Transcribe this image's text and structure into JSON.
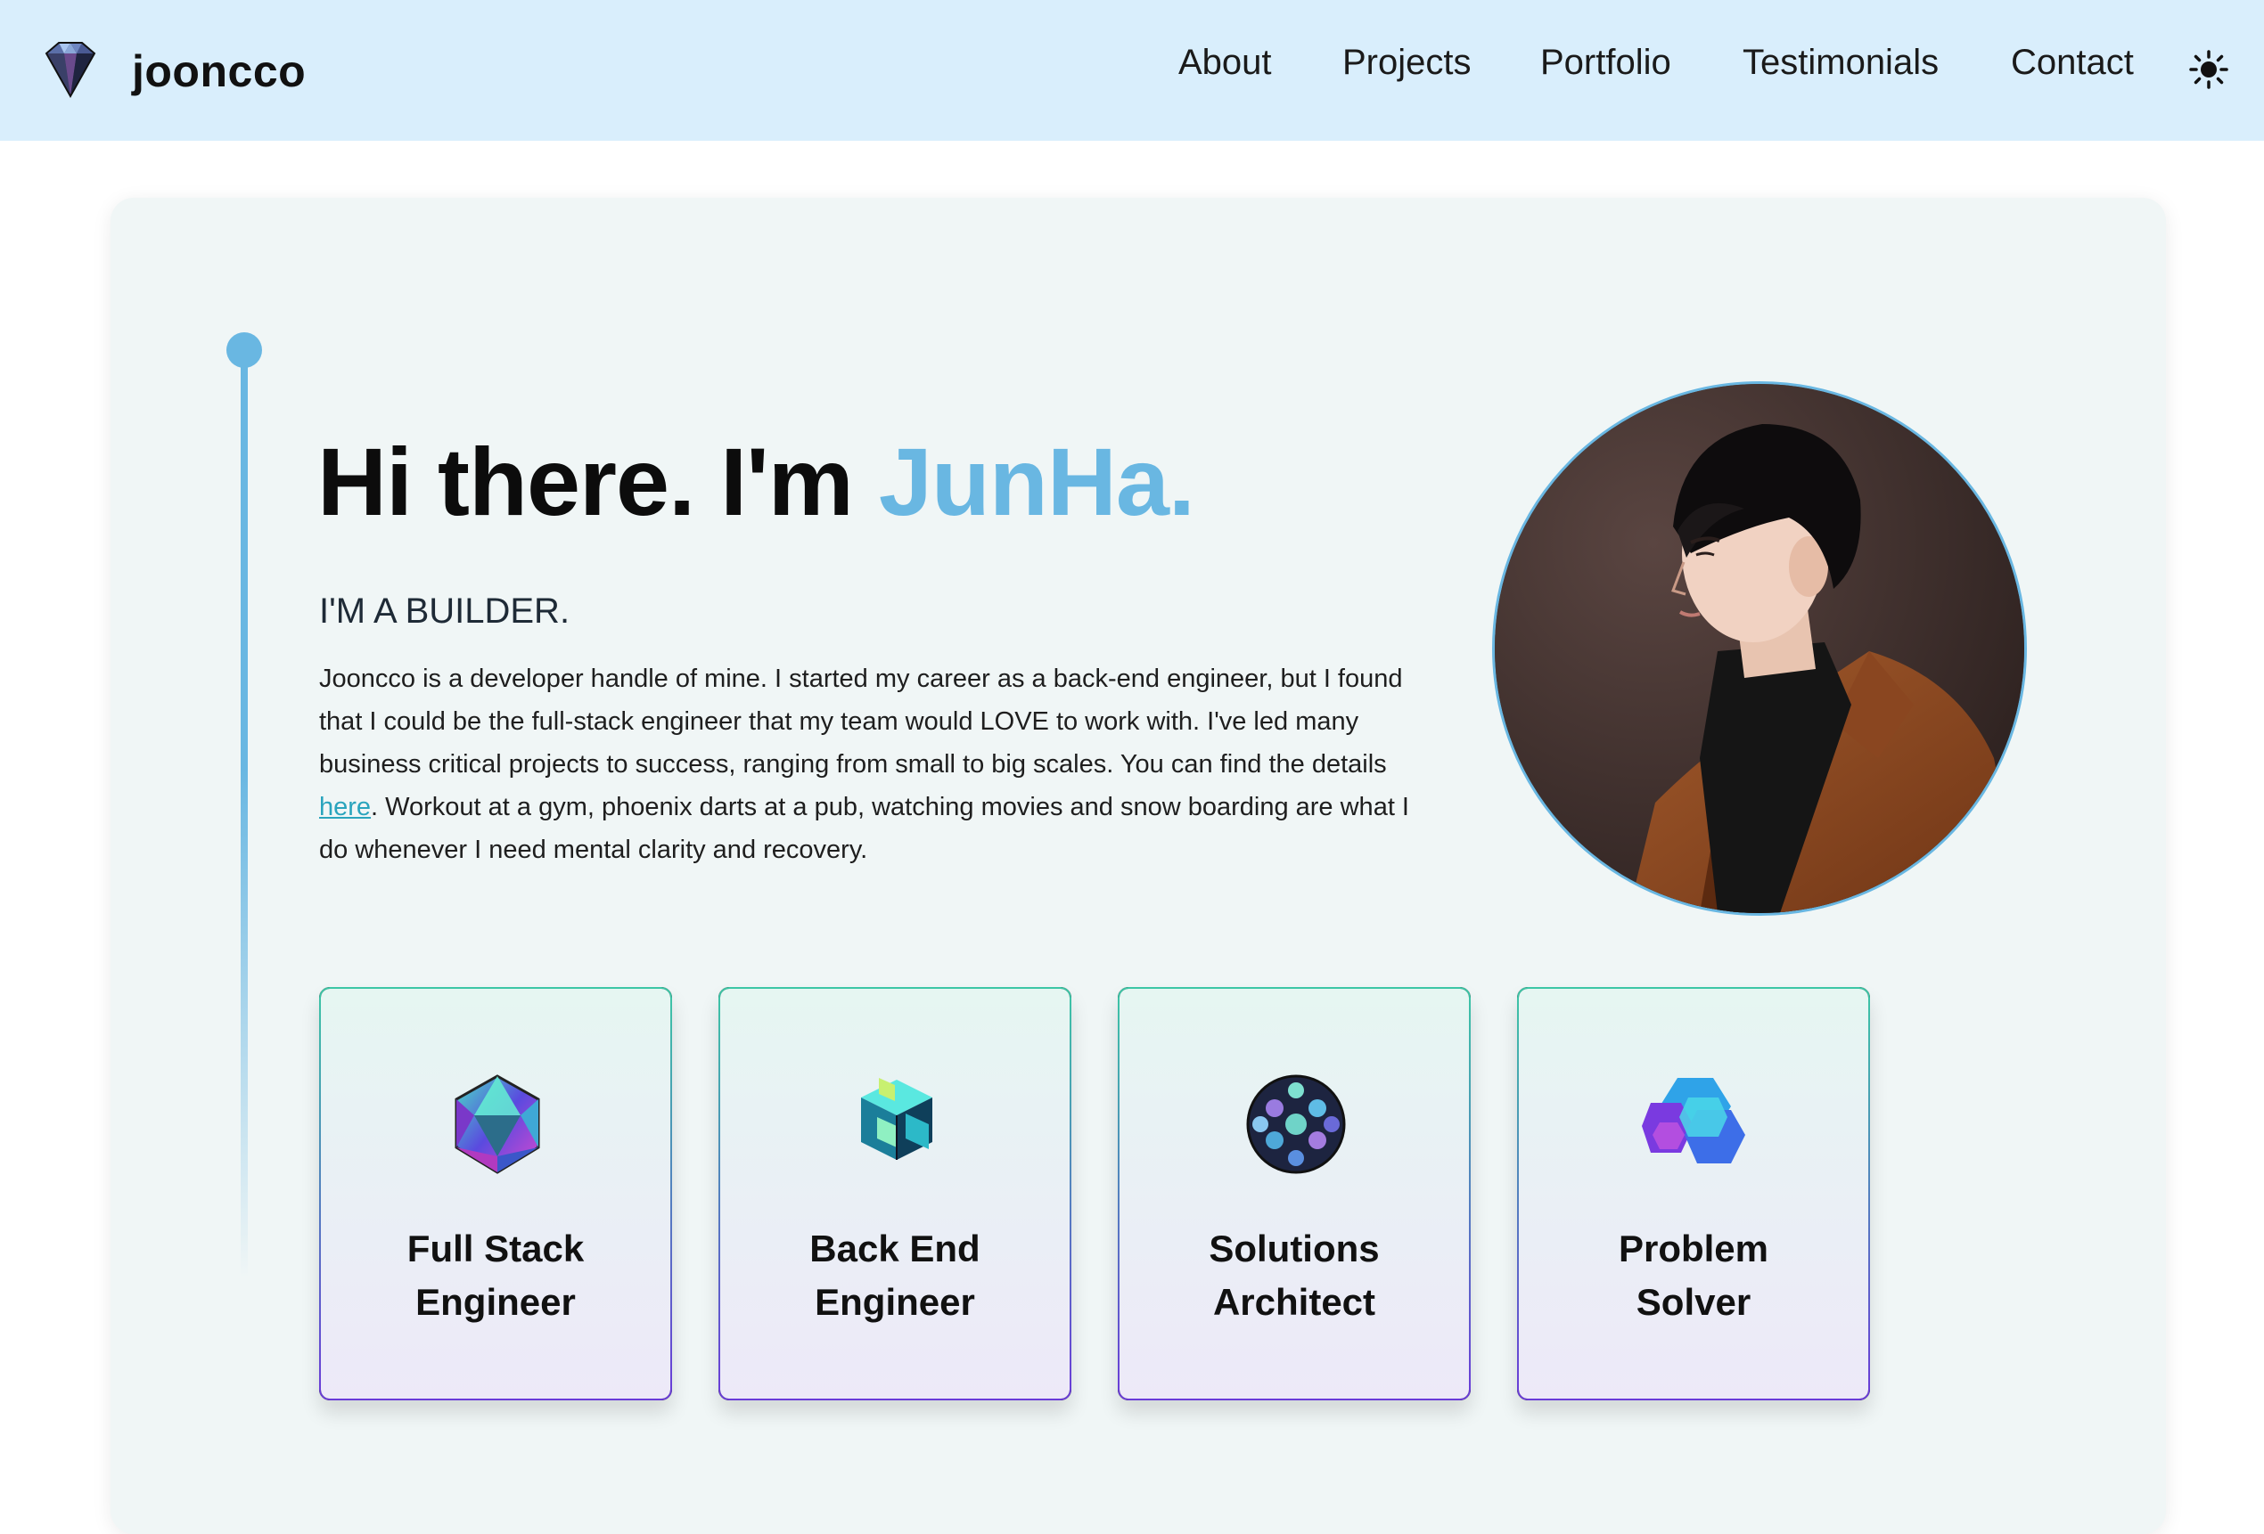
{
  "brand": {
    "name": "jooncco"
  },
  "nav": {
    "items": [
      {
        "label": "About"
      },
      {
        "label": "Projects"
      },
      {
        "label": "Portfolio"
      },
      {
        "label": "Testimonials"
      },
      {
        "label": "Contact"
      }
    ]
  },
  "hero": {
    "greeting": "Hi there. I'm ",
    "name": "JunHa.",
    "subtitle": "I'M A BUILDER.",
    "bio_before_link": "Jooncco is a developer handle of mine. I started my career as a back-end engineer, but I found that I could be the full-stack engineer that my team would LOVE to work with. I've led many business critical projects to success, ranging from small to big scales. You can find the details ",
    "bio_link": "here",
    "bio_after_link": ". Workout at a gym, phoenix darts at a pub, watching movies and snow boarding are what I do whenever I need mental clarity and recovery."
  },
  "roles": [
    {
      "line1": "Full Stack",
      "line2": "Engineer"
    },
    {
      "line1": "Back End",
      "line2": "Engineer"
    },
    {
      "line1": "Solutions",
      "line2": "Architect"
    },
    {
      "line1": "Problem",
      "line2": "Solver"
    }
  ],
  "colors": {
    "accent": "#69b7e2",
    "nav_bg": "#d9eefc",
    "card_bg": "#f0f6f6",
    "link": "#2aa4bd"
  },
  "icons": {
    "brand": "diamond-logo-icon",
    "theme": "sun-icon"
  }
}
